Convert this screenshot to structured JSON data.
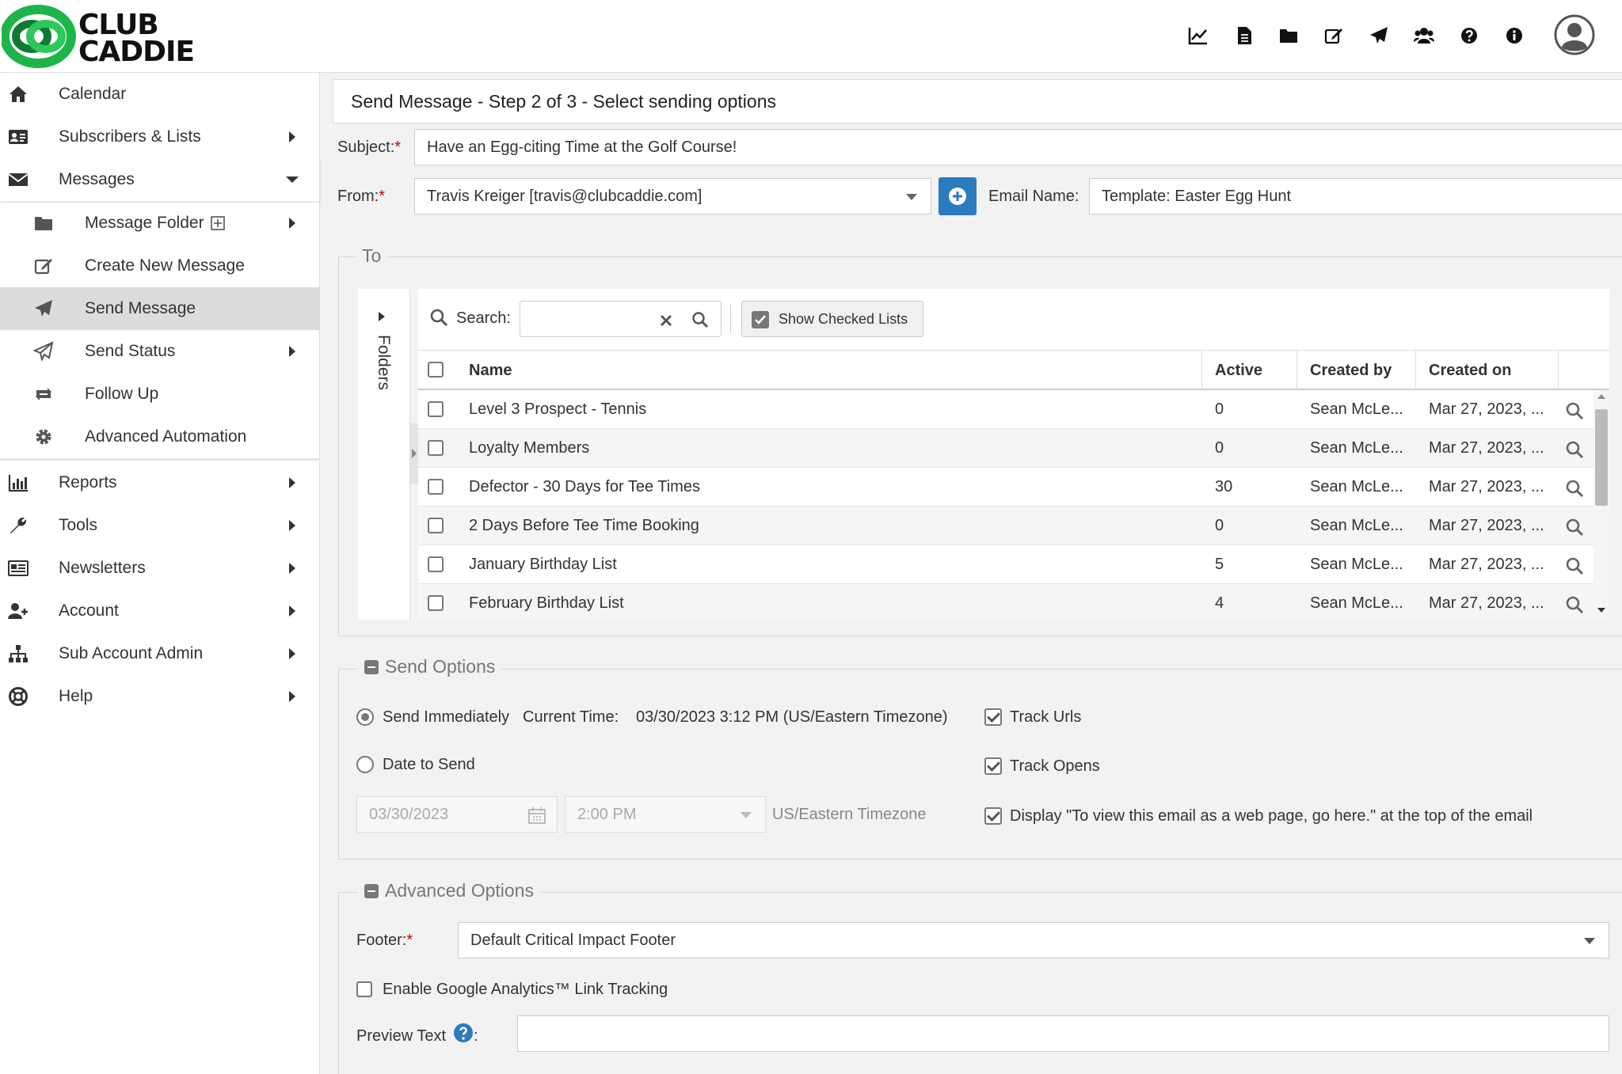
{
  "brand": {
    "name_line1": "CLUB",
    "name_line2": "CADDIE",
    "color_green": "#1db54a",
    "color_dark_green": "#0e7a32"
  },
  "top_icons": [
    "chart-line-icon",
    "document-icon",
    "folder-icon",
    "edit-icon",
    "paper-plane-icon",
    "users-icon",
    "question-circle-icon",
    "info-circle-icon",
    "user-avatar-icon"
  ],
  "sidebar": {
    "items": [
      {
        "label": "Calendar",
        "icon": "home-icon"
      },
      {
        "label": "Subscribers & Lists",
        "icon": "address-card-icon"
      },
      {
        "label": "Messages",
        "icon": "envelope-icon"
      },
      {
        "label": "Message Folder",
        "icon": "folder-icon"
      },
      {
        "label": "Create New Message",
        "icon": "edit-icon"
      },
      {
        "label": "Send Message",
        "icon": "paper-plane-icon"
      },
      {
        "label": "Send Status",
        "icon": "paper-plane-outline-icon"
      },
      {
        "label": "Follow Up",
        "icon": "retweet-icon"
      },
      {
        "label": "Advanced Automation",
        "icon": "gear-icon"
      },
      {
        "label": "Reports",
        "icon": "bar-chart-icon"
      },
      {
        "label": "Tools",
        "icon": "wrench-icon"
      },
      {
        "label": "Newsletters",
        "icon": "newspaper-icon"
      },
      {
        "label": "Account",
        "icon": "user-plus-icon"
      },
      {
        "label": "Sub Account Admin",
        "icon": "sitemap-icon"
      },
      {
        "label": "Help",
        "icon": "life-ring-icon"
      }
    ]
  },
  "page": {
    "title": "Send Message - Step 2 of 3 - Select sending options",
    "subject_label": "Subject:",
    "subject_value": "Have an Egg-citing Time at the Golf Course!",
    "from_label": "From:",
    "from_value": "Travis Kreiger  [travis@clubcaddie.com]",
    "email_name_label": "Email Name:",
    "email_name_value": "Template: Easter Egg Hunt",
    "required_mark": "*"
  },
  "to_section": {
    "legend": "To",
    "folders_label": "Folders",
    "search_label": "Search:",
    "search_value": "",
    "show_checked_label": "Show Checked Lists",
    "columns": [
      "Name",
      "Active",
      "Created by",
      "Created on"
    ],
    "rows": [
      {
        "name": "Level 3 Prospect - Tennis",
        "active": "0",
        "created_by": "Sean McLe...",
        "created_on": "Mar 27, 2023, ..."
      },
      {
        "name": "Loyalty Members",
        "active": "0",
        "created_by": "Sean McLe...",
        "created_on": "Mar 27, 2023, ..."
      },
      {
        "name": "Defector - 30 Days for Tee Times",
        "active": "30",
        "created_by": "Sean McLe...",
        "created_on": "Mar 27, 2023, ..."
      },
      {
        "name": "2 Days Before Tee Time Booking",
        "active": "0",
        "created_by": "Sean McLe...",
        "created_on": "Mar 27, 2023, ..."
      },
      {
        "name": "January Birthday List",
        "active": "5",
        "created_by": "Sean McLe...",
        "created_on": "Mar 27, 2023, ..."
      },
      {
        "name": "February Birthday List",
        "active": "4",
        "created_by": "Sean McLe...",
        "created_on": "Mar 27, 2023, ..."
      }
    ]
  },
  "send_options": {
    "legend": "Send Options",
    "send_immediately": "Send Immediately",
    "current_time_label": "Current Time:",
    "current_time_value": "03/30/2023 3:12 PM (US/Eastern Timezone)",
    "date_to_send": "Date to Send",
    "date_value": "03/30/2023",
    "time_value": "2:00 PM",
    "timezone": "US/Eastern Timezone",
    "track_urls": "Track Urls",
    "track_opens": "Track Opens",
    "display_web_link": "Display \"To view this email as a web page, go here.\" at the top of the email"
  },
  "advanced_options": {
    "legend": "Advanced Options",
    "footer_label": "Footer:",
    "footer_value": "Default Critical Impact Footer",
    "ga_label": "Enable Google Analytics™ Link Tracking",
    "preview_text_label": "Preview Text",
    "preview_text_colon": ":",
    "preview_text_value": ""
  }
}
